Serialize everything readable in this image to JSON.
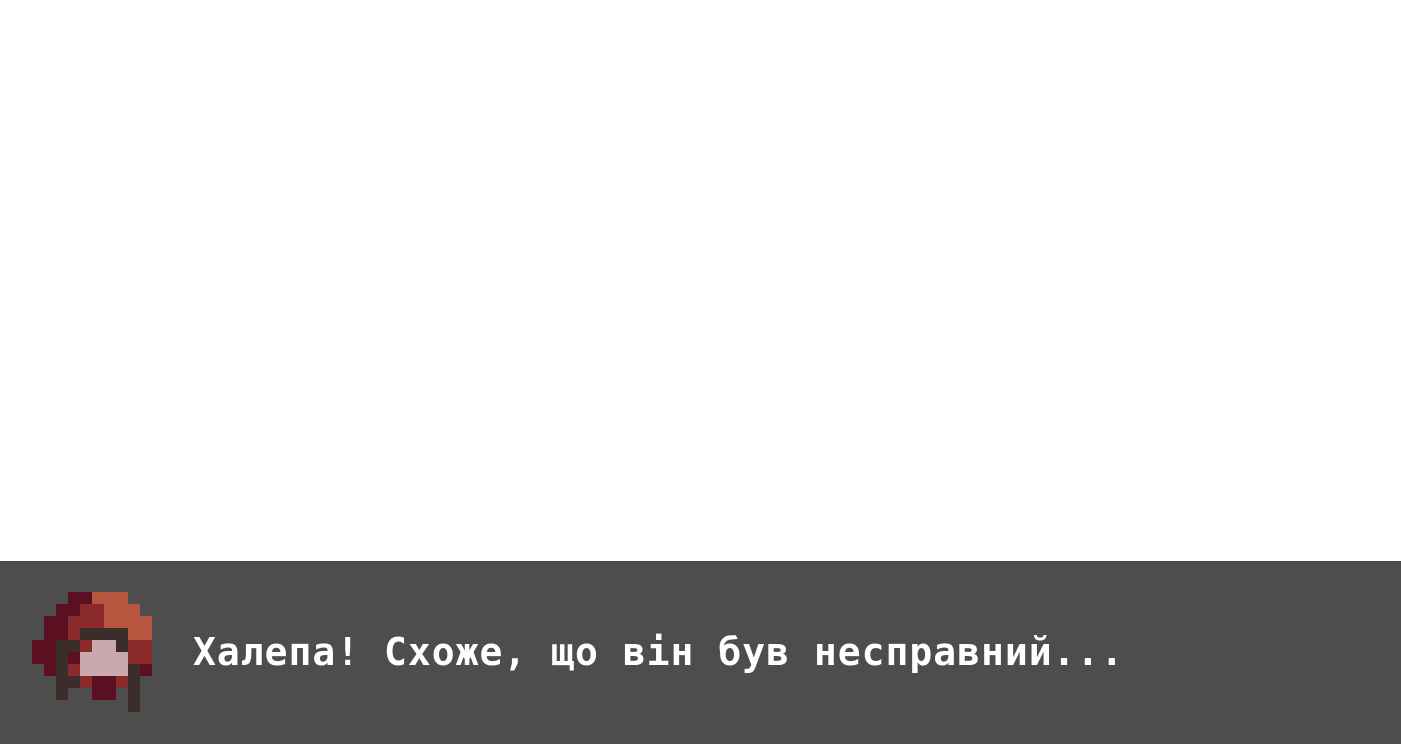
{
  "dialog": {
    "text": "Халепа! Схоже, що він був несправний...",
    "portrait_icon": "red-hooded-character-portrait"
  },
  "colors": {
    "scene_background": "#ffffff",
    "dialog_background": "#4d4d4d",
    "text": "#ffffff",
    "hood_dark": "#5a1020",
    "hood_mid": "#8a2a2a",
    "hood_light": "#b8553f",
    "face": "#c9a9ad",
    "hair": "#3a2d2a"
  }
}
